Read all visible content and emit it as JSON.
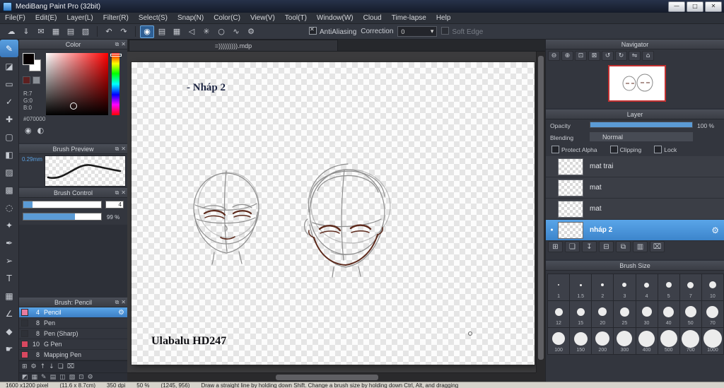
{
  "window": {
    "title": "MediBang Paint Pro (32bit)",
    "controls": [
      {
        "name": "minimize-button",
        "glyph": "—"
      },
      {
        "name": "restore-button",
        "glyph": "□"
      },
      {
        "name": "close-button",
        "glyph": "✕"
      }
    ]
  },
  "menu_bar": {
    "items": [
      "File(F)",
      "Edit(E)",
      "Layer(L)",
      "Filter(R)",
      "Select(S)",
      "Snap(N)",
      "Color(C)",
      "View(V)",
      "Tool(T)",
      "Window(W)",
      "Cloud",
      "Time-lapse",
      "Help"
    ]
  },
  "toolbar": {
    "file_icons": [
      {
        "name": "cloud-icon",
        "glyph": "☁"
      },
      {
        "name": "save-icon",
        "glyph": "⇓"
      },
      {
        "name": "comment-icon",
        "glyph": "✉"
      },
      {
        "name": "material-panel-icon",
        "glyph": "▦"
      },
      {
        "name": "panel-layout-icon",
        "glyph": "▤"
      },
      {
        "name": "workspace-icon",
        "glyph": "▧"
      }
    ],
    "history_icons": [
      {
        "name": "undo-icon",
        "glyph": "↶"
      },
      {
        "name": "redo-icon",
        "glyph": "↷"
      }
    ],
    "mode_icons": [
      {
        "name": "freehand-snap-off-icon",
        "glyph": "◉",
        "selected": true
      },
      {
        "name": "parallel-snap-icon",
        "glyph": "▤"
      },
      {
        "name": "cross-snap-icon",
        "glyph": "▦"
      },
      {
        "name": "vanishing-point-snap-icon",
        "glyph": "◁"
      },
      {
        "name": "radial-snap-icon",
        "glyph": "✳"
      },
      {
        "name": "ellipse-snap-icon",
        "glyph": "○"
      },
      {
        "name": "curve-snap-icon",
        "glyph": "∿"
      },
      {
        "name": "snap-settings-icon",
        "glyph": "⚙"
      }
    ],
    "antialiasing": {
      "label": "AntiAliasing",
      "checked": true
    },
    "correction": {
      "label": "Correction",
      "value": "0",
      "arrow": "▾"
    },
    "soft_edge": {
      "label": "Soft Edge",
      "checked": false
    }
  },
  "tool_strip": {
    "tools": [
      {
        "name": "brush-tool-icon",
        "glyph": "✎",
        "selected": true
      },
      {
        "name": "eraser-tool-icon",
        "glyph": "◪"
      },
      {
        "name": "shape-brush-tool-icon",
        "glyph": "▭"
      },
      {
        "name": "dot-pen-tool-icon",
        "glyph": "✓"
      },
      {
        "name": "move-tool-icon",
        "glyph": "✚"
      },
      {
        "name": "select-rect-tool-icon",
        "glyph": "▢"
      },
      {
        "name": "bucket-fill-tool-icon",
        "glyph": "◧"
      },
      {
        "name": "gradient-tool-icon",
        "glyph": "▨"
      },
      {
        "name": "select-move-tool-icon",
        "glyph": "▩"
      },
      {
        "name": "lasso-tool-icon",
        "glyph": "◌"
      },
      {
        "name": "magic-wand-tool-icon",
        "glyph": "✦"
      },
      {
        "name": "pen-tool-icon",
        "glyph": "✒"
      },
      {
        "name": "operation-tool-icon",
        "glyph": "➢"
      },
      {
        "name": "text-tool-icon",
        "glyph": "T"
      },
      {
        "name": "divide-tool-icon",
        "glyph": "▦"
      },
      {
        "name": "measure-tool-icon",
        "glyph": "∠"
      },
      {
        "name": "eyedropper-tool-icon",
        "glyph": "◆"
      },
      {
        "name": "hand-tool-icon",
        "glyph": "☛"
      }
    ]
  },
  "panel_header_icons": [
    {
      "name": "popout-icon",
      "glyph": "⧉"
    },
    {
      "name": "close-icon",
      "glyph": "✕"
    }
  ],
  "color_panel": {
    "title": "Color",
    "r": "R:7",
    "g": "G:0",
    "b": "B:0",
    "hex": "#070000",
    "swatches": [
      "#5e2020",
      "#8a8f96"
    ],
    "icons": [
      {
        "name": "color-wheel-icon",
        "glyph": "◉"
      },
      {
        "name": "palette-toggle-icon",
        "glyph": "◐"
      }
    ]
  },
  "brush_preview": {
    "title": "Brush Preview",
    "size": "0.29mm"
  },
  "brush_control": {
    "title": "Brush Control",
    "size_value": "4",
    "size_fill": 0.12,
    "opacity_value": "99 %",
    "opacity_fill": 0.66
  },
  "brush_list": {
    "title": "Brush: Pencil",
    "items": [
      {
        "size": "4",
        "name": "Pencil",
        "selected": true,
        "chip": "#e87da0"
      },
      {
        "size": "8",
        "name": "Pen",
        "chip": "#2e3138"
      },
      {
        "size": "8",
        "name": "Pen (Sharp)",
        "chip": "#2e3138"
      },
      {
        "size": "10",
        "name": "G Pen",
        "chip": "#d84860"
      },
      {
        "size": "8",
        "name": "Mapping Pen",
        "chip": "#d84860"
      }
    ],
    "toolbar": [
      {
        "name": "add-brush-icon",
        "glyph": "⊞"
      },
      {
        "name": "brush-settings-icon",
        "glyph": "⚙"
      },
      {
        "name": "brush-up-icon",
        "glyph": "↑"
      },
      {
        "name": "brush-down-icon",
        "glyph": "↓"
      },
      {
        "name": "duplicate-brush-icon",
        "glyph": "❏"
      },
      {
        "name": "delete-brush-icon",
        "glyph": "⌧"
      }
    ]
  },
  "dock_icons": [
    {
      "name": "color-dock-icon",
      "glyph": "◩"
    },
    {
      "name": "palette-dock-icon",
      "glyph": "▦"
    },
    {
      "name": "brush-dock-icon",
      "glyph": "✎"
    },
    {
      "name": "control-dock-icon",
      "glyph": "▤"
    },
    {
      "name": "preview-dock-icon",
      "glyph": "◫"
    },
    {
      "name": "material-dock-icon",
      "glyph": "▧"
    },
    {
      "name": "navigator-dock-icon",
      "glyph": "⊡"
    },
    {
      "name": "settings-dock-icon",
      "glyph": "⚙"
    }
  ],
  "canvas": {
    "tab": "=))))))))).mdp",
    "note_top": "- Nháp 2",
    "note_bottom": "Ulabalu HD247"
  },
  "navigator": {
    "title": "Navigator",
    "icons": [
      {
        "name": "zoom-out-icon",
        "glyph": "⊖"
      },
      {
        "name": "zoom-in-icon",
        "glyph": "⊕"
      },
      {
        "name": "fit-window-icon",
        "glyph": "⊡"
      },
      {
        "name": "actual-size-icon",
        "glyph": "⊠"
      },
      {
        "name": "rotate-ccw-icon",
        "glyph": "↺"
      },
      {
        "name": "rotate-cw-icon",
        "glyph": "↻"
      },
      {
        "name": "flip-horizontal-icon",
        "glyph": "⇋"
      },
      {
        "name": "reset-view-icon",
        "glyph": "⌂"
      }
    ]
  },
  "layer_panel": {
    "title": "Layer",
    "opacity_label": "Opacity",
    "opacity_value": "100 %",
    "opacity_fill": 1,
    "blending_label": "Blending",
    "blending_value": "Normal",
    "checkboxes": [
      "Protect Alpha",
      "Clipping",
      "Lock"
    ],
    "layers": [
      {
        "name": "mat trai",
        "selected": false
      },
      {
        "name": "mat",
        "selected": false
      },
      {
        "name": "mat",
        "selected": false
      },
      {
        "name": "nháp 2",
        "selected": true
      }
    ],
    "toolbar": [
      {
        "name": "add-layer-icon",
        "glyph": "⊞"
      },
      {
        "name": "duplicate-layer-icon",
        "glyph": "❏"
      },
      {
        "name": "merge-down-icon",
        "glyph": "↧"
      },
      {
        "name": "add-folder-icon",
        "glyph": "⊟"
      },
      {
        "name": "copy-layer-icon",
        "glyph": "⧉"
      },
      {
        "name": "layer-settings-icon",
        "glyph": "▥"
      },
      {
        "name": "delete-layer-icon",
        "glyph": "⌧"
      }
    ]
  },
  "brush_size_panel": {
    "title": "Brush Size",
    "sizes": [
      "1",
      "1.5",
      "2",
      "3",
      "4",
      "5",
      "7",
      "10",
      "12",
      "15",
      "20",
      "25",
      "30",
      "40",
      "50",
      "70",
      "100",
      "150",
      "200",
      "300",
      "400",
      "500",
      "700",
      "1000"
    ]
  },
  "status_bar": {
    "segments": [
      "1600 x1200 pixel",
      "(11.6 x 8.7cm)",
      "350 dpi",
      "50 %",
      "(1245, 956)",
      "Draw a straight line by holding down Shift. Change a brush size by holding down Ctrl, Alt, and dragging"
    ]
  },
  "colors": {
    "accent_blue": "#4a90d8",
    "selected_layer_blue": "#4a8fd0",
    "selected_color_hex": "#070000",
    "navigator_frame_red": "#c23030"
  }
}
